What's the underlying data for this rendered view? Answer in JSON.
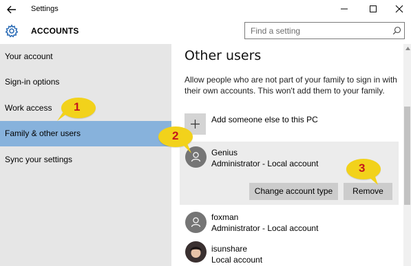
{
  "window": {
    "title": "Settings",
    "controls": [
      "minimize",
      "maximize",
      "close"
    ]
  },
  "header": {
    "title": "ACCOUNTS",
    "search_placeholder": "Find a setting"
  },
  "sidebar": {
    "items": [
      {
        "label": "Your account",
        "active": false
      },
      {
        "label": "Sign-in options",
        "active": false
      },
      {
        "label": "Work access",
        "active": false
      },
      {
        "label": "Family & other users",
        "active": true
      },
      {
        "label": "Sync your settings",
        "active": false
      }
    ]
  },
  "main": {
    "heading": "Other users",
    "description": "Allow people who are not part of your family to sign in with their own accounts. This won't add them to your family.",
    "add_label": "Add someone else to this PC",
    "users": [
      {
        "name": "Genius",
        "role": "Administrator - Local account",
        "selected": true
      },
      {
        "name": "foxman",
        "role": "Administrator - Local account",
        "selected": false
      },
      {
        "name": "isunshare",
        "role": "Local account",
        "selected": false
      }
    ],
    "buttons": {
      "change_type": "Change account type",
      "remove": "Remove"
    }
  },
  "markers": [
    "1",
    "2",
    "3"
  ],
  "colors": {
    "sidebar_bg": "#e6e6e6",
    "active_item": "#87b2dc",
    "accent_icon": "#2b6cb6",
    "marker": "#f2d21b",
    "marker_text": "#c4161c"
  }
}
